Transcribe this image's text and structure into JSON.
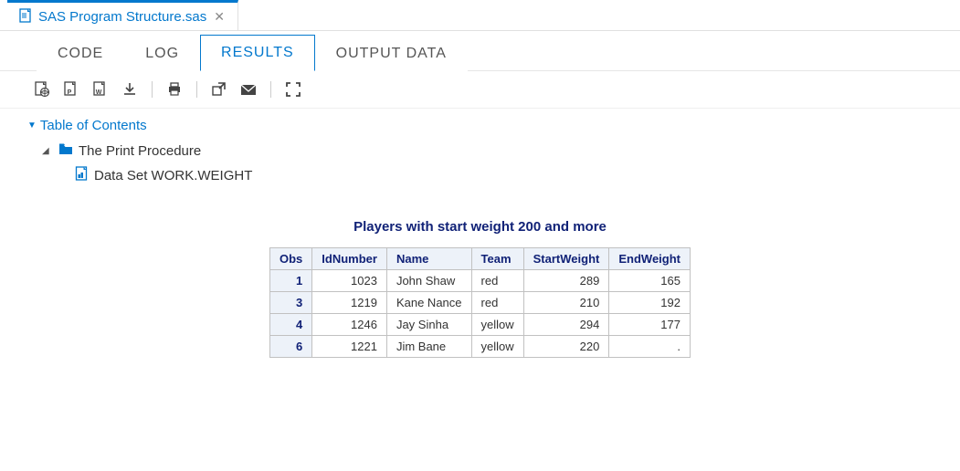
{
  "fileTab": {
    "name": "SAS Program Structure.sas"
  },
  "subTabs": {
    "code": "CODE",
    "log": "LOG",
    "results": "RESULTS",
    "output": "OUTPUT DATA"
  },
  "toc": {
    "header": "Table of Contents",
    "proc": "The Print Procedure",
    "dataset": "Data Set WORK.WEIGHT"
  },
  "result": {
    "title": "Players with start weight 200 and more",
    "headers": {
      "obs": "Obs",
      "id": "IdNumber",
      "name": "Name",
      "team": "Team",
      "start": "StartWeight",
      "end": "EndWeight"
    },
    "rows": [
      {
        "obs": "1",
        "id": "1023",
        "name": "John Shaw",
        "team": "red",
        "start": "289",
        "end": "165"
      },
      {
        "obs": "3",
        "id": "1219",
        "name": "Kane Nance",
        "team": "red",
        "start": "210",
        "end": "192"
      },
      {
        "obs": "4",
        "id": "1246",
        "name": "Jay Sinha",
        "team": "yellow",
        "start": "294",
        "end": "177"
      },
      {
        "obs": "6",
        "id": "1221",
        "name": "Jim Bane",
        "team": "yellow",
        "start": "220",
        "end": "."
      }
    ]
  }
}
